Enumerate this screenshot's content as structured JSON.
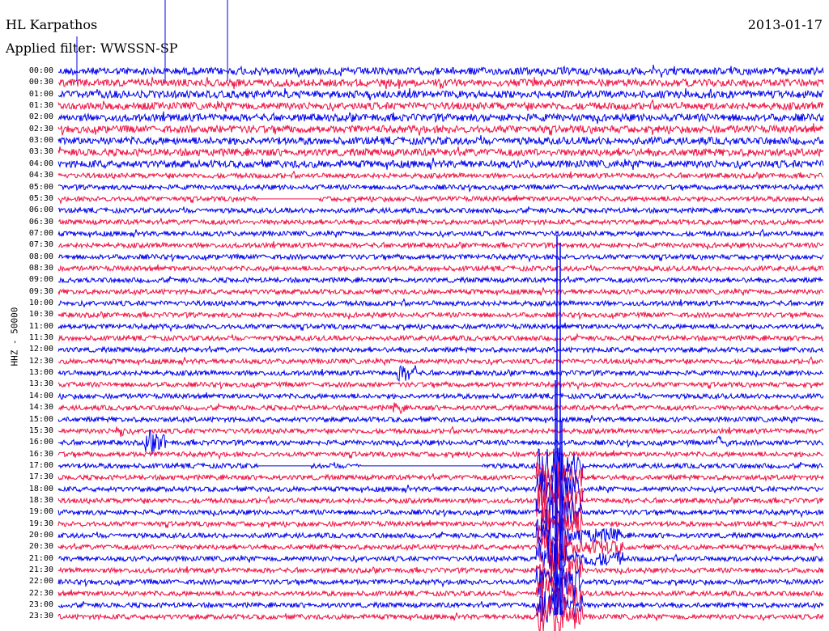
{
  "header": {
    "station": "HL Karpathos",
    "date": "2013-01-17",
    "filter_label": "Applied filter: WWSSN-SP",
    "channel_label": "HHZ - 50000"
  },
  "colors": {
    "odd_trace": "#0000ee",
    "even_trace": "#ee1144",
    "background": "#ffffff"
  },
  "time_labels": [
    "00:00",
    "00:30",
    "01:00",
    "01:30",
    "02:00",
    "02:30",
    "03:00",
    "03:30",
    "04:00",
    "04:30",
    "05:00",
    "05:30",
    "06:00",
    "06:30",
    "07:00",
    "07:30",
    "08:00",
    "08:30",
    "09:00",
    "09:30",
    "10:00",
    "10:30",
    "11:00",
    "11:30",
    "12:00",
    "12:30",
    "13:00",
    "13:30",
    "14:00",
    "14:30",
    "15:00",
    "15:30",
    "16:00",
    "16:30",
    "17:00",
    "17:30",
    "18:00",
    "18:30",
    "19:00",
    "19:30",
    "20:00",
    "20:30",
    "21:00",
    "21:30",
    "22:00",
    "22:30",
    "23:00",
    "23:30"
  ]
}
